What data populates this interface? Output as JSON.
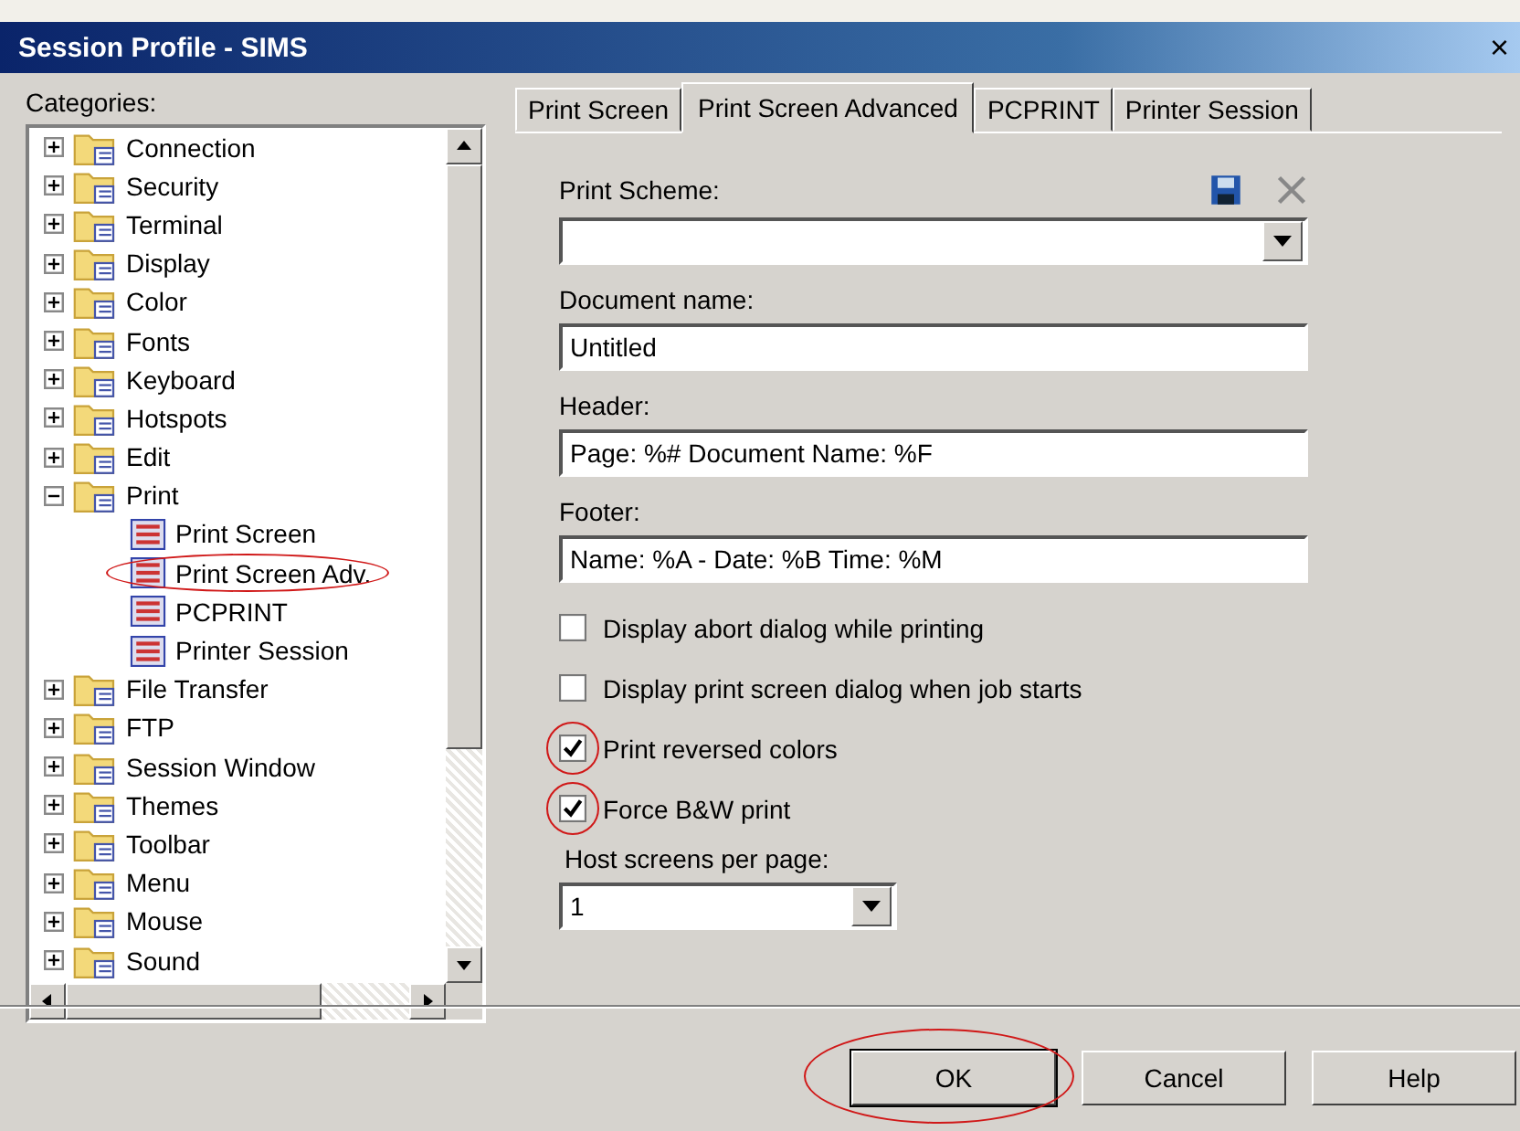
{
  "window": {
    "title": "Session Profile - SIMS",
    "close": "×"
  },
  "categories": {
    "label": "Categories:",
    "items": [
      {
        "label": "Connection",
        "expanded": false
      },
      {
        "label": "Security",
        "expanded": false
      },
      {
        "label": "Terminal",
        "expanded": false
      },
      {
        "label": "Display",
        "expanded": false
      },
      {
        "label": "Color",
        "expanded": false
      },
      {
        "label": "Fonts",
        "expanded": false
      },
      {
        "label": "Keyboard",
        "expanded": false
      },
      {
        "label": "Hotspots",
        "expanded": false
      },
      {
        "label": "Edit",
        "expanded": false
      },
      {
        "label": "Print",
        "expanded": true,
        "children": [
          {
            "label": "Print Screen",
            "circled": false
          },
          {
            "label": "Print Screen Adv.",
            "circled": true
          },
          {
            "label": "PCPRINT",
            "circled": false
          },
          {
            "label": "Printer Session",
            "circled": false
          }
        ]
      },
      {
        "label": "File Transfer",
        "expanded": false
      },
      {
        "label": "FTP",
        "expanded": false
      },
      {
        "label": "Session Window",
        "expanded": false
      },
      {
        "label": "Themes",
        "expanded": false
      },
      {
        "label": "Toolbar",
        "expanded": false
      },
      {
        "label": "Menu",
        "expanded": false
      },
      {
        "label": "Mouse",
        "expanded": false
      },
      {
        "label": "Sound",
        "expanded": false
      }
    ]
  },
  "tabs": [
    {
      "label": "Print Screen",
      "selected": false
    },
    {
      "label": "Print Screen Advanced",
      "selected": true
    },
    {
      "label": "PCPRINT",
      "selected": false
    },
    {
      "label": "Printer Session",
      "selected": false
    }
  ],
  "print_scheme": {
    "label": "Print Scheme:"
  },
  "document_name": {
    "label": "Document name:",
    "value": "Untitled"
  },
  "header": {
    "label": "Header:",
    "value": "Page: %#  Document Name: %F"
  },
  "footer": {
    "label": "Footer:",
    "value": "Name: %A - Date: %B  Time: %M"
  },
  "options": [
    {
      "label": "Display abort dialog while printing",
      "checked": false,
      "circled": false
    },
    {
      "label": "Display print screen dialog when job starts",
      "checked": false,
      "circled": false
    },
    {
      "label": "Print reversed colors",
      "checked": true,
      "circled": true
    },
    {
      "label": "Force B&W print",
      "checked": true,
      "circled": true
    }
  ],
  "host_screens": {
    "label": "Host screens per page:",
    "value": "1"
  },
  "buttons": [
    {
      "label": "OK",
      "circled": true
    },
    {
      "label": "Cancel",
      "circled": false
    },
    {
      "label": "Help",
      "circled": false
    }
  ]
}
